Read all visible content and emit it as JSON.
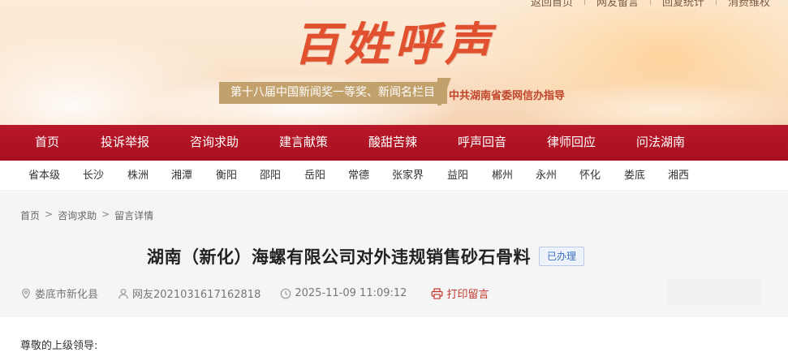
{
  "top_links": [
    "返回首页",
    "网友留言",
    "回复统计",
    "消费维权"
  ],
  "banner": {
    "logo_text": "百姓呼声",
    "tagline": "第十八届中国新闻奖一等奖、新闻名栏目",
    "guide": "中共湖南省委网信办指导"
  },
  "main_nav": [
    "首页",
    "投诉举报",
    "咨询求助",
    "建言献策",
    "酸甜苦辣",
    "呼声回音",
    "律师回应",
    "问法湖南"
  ],
  "city_nav": [
    "省本级",
    "长沙",
    "株洲",
    "湘潭",
    "衡阳",
    "邵阳",
    "岳阳",
    "常德",
    "张家界",
    "益阳",
    "郴州",
    "永州",
    "怀化",
    "娄底",
    "湘西"
  ],
  "breadcrumb": {
    "home": "首页",
    "section": "咨询求助",
    "current": "留言详情",
    "separator": ">"
  },
  "post": {
    "title": "湖南（新化）海螺有限公司对外违规销售砂石骨料",
    "status": "已办理",
    "location": "娄底市新化县",
    "author": "网友2021031617162818",
    "time": "2025-11-09 11:09:12",
    "print_label": "打印留言",
    "greeting": "尊敬的上级领导:"
  },
  "colors": {
    "nav_red": "#b01424",
    "logo_red": "#e1502f",
    "tagline_gold": "#c3a16c",
    "status_blue": "#3a6fc1",
    "print_red": "#c0392b"
  }
}
